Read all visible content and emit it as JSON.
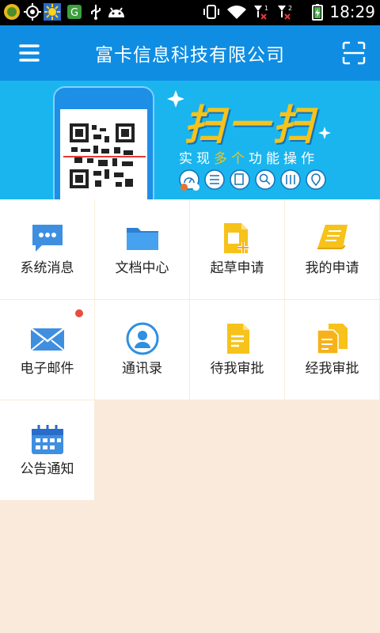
{
  "status_bar": {
    "time": "18:29",
    "icons": [
      "app-icon",
      "gps-icon",
      "weather-icon",
      "security-icon",
      "usb-icon",
      "android-icon",
      "vibrate-icon",
      "wifi-icon",
      "signal-1-icon",
      "signal-2-icon",
      "battery-charging-icon"
    ]
  },
  "header": {
    "title": "富卡信息科技有限公司",
    "menu_icon": "menu-icon",
    "scan_icon": "scan-icon"
  },
  "banner": {
    "headline": "扫一扫",
    "subtitle_prefix": "实现",
    "subtitle_highlight": "多个",
    "subtitle_suffix": "功能操作",
    "feature_icons": [
      "speedometer-icon",
      "list-icon",
      "document-icon",
      "search-icon",
      "settings-icon",
      "location-icon"
    ],
    "slides_total": 2,
    "active_slide": 1
  },
  "grid": {
    "items": [
      {
        "label": "系统消息",
        "icon": "chat-bubble-icon"
      },
      {
        "label": "文档中心",
        "icon": "folder-icon"
      },
      {
        "label": "起草申请",
        "icon": "new-document-icon"
      },
      {
        "label": "我的申请",
        "icon": "scroll-icon"
      },
      {
        "label": "电子邮件",
        "icon": "mail-icon",
        "badge": true
      },
      {
        "label": "通讯录",
        "icon": "contacts-icon"
      },
      {
        "label": "待我审批",
        "icon": "pending-document-icon"
      },
      {
        "label": "经我审批",
        "icon": "approved-documents-icon"
      },
      {
        "label": "公告通知",
        "icon": "calendar-icon"
      }
    ]
  },
  "colors": {
    "header": "#0f8de2",
    "banner": "#1ab5ee",
    "background": "#f9eadb",
    "accent_yellow": "#f7c21a",
    "accent_blue": "#3f8fe0",
    "badge_red": "#e84c3d"
  }
}
